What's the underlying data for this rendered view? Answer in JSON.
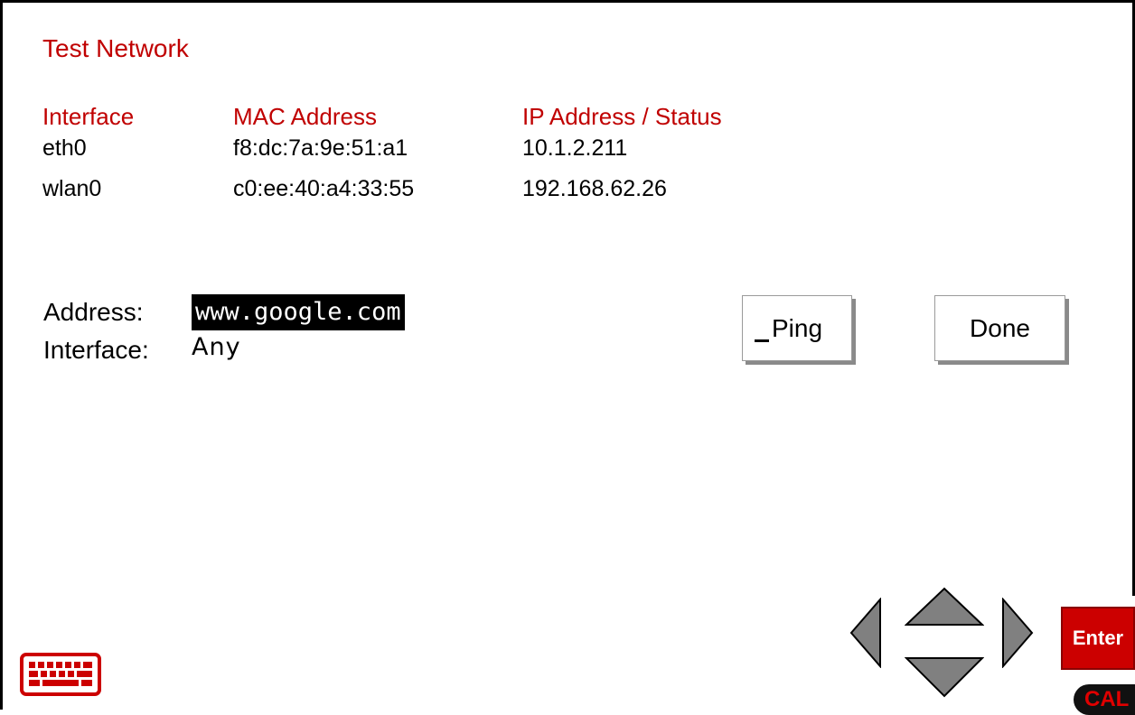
{
  "page": {
    "title": "Test Network"
  },
  "table": {
    "headers": [
      "Interface",
      "MAC Address",
      "IP Address / Status"
    ],
    "rows": [
      [
        "eth0",
        "f8:dc:7a:9e:51:a1",
        "10.1.2.211"
      ],
      [
        "wlan0",
        "c0:ee:40:a4:33:55",
        "192.168.62.26"
      ]
    ]
  },
  "form": {
    "address_label": "Address:",
    "address_value": "www.google.com",
    "interface_label": "Interface:",
    "interface_value": "Any"
  },
  "buttons": {
    "ping": "Ping",
    "done": "Done",
    "enter": "Enter"
  },
  "badge": {
    "cal": "CAL"
  },
  "icons": {
    "keyboard": "keyboard-icon",
    "left": "arrow-left-icon",
    "up": "arrow-up-icon",
    "down": "arrow-down-icon",
    "right": "arrow-right-icon"
  },
  "colors": {
    "accent": "#c00000",
    "enter": "#cc0000"
  }
}
